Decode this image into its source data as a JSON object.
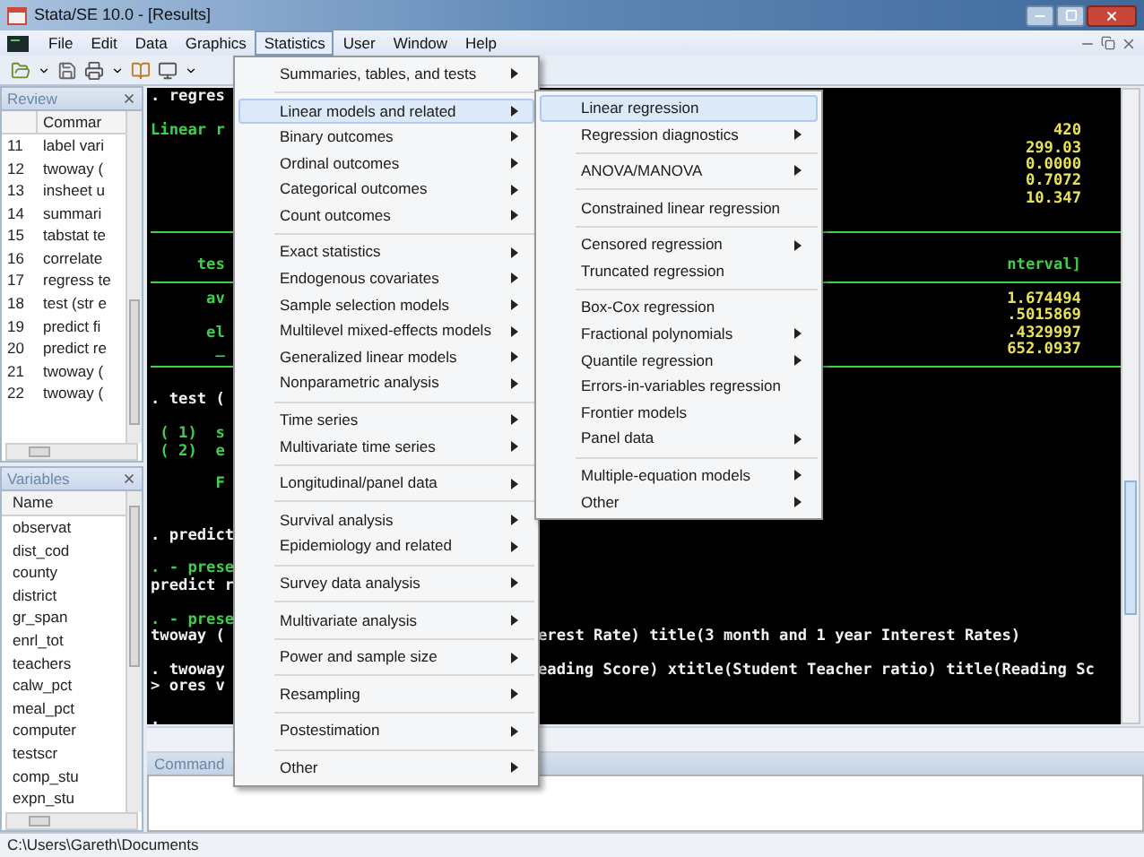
{
  "window": {
    "title": "Stata/SE 10.0 - [Results]"
  },
  "menubar": [
    {
      "label": "File",
      "selected": false
    },
    {
      "label": "Edit",
      "selected": false
    },
    {
      "label": "Data",
      "selected": false
    },
    {
      "label": "Graphics",
      "selected": false
    },
    {
      "label": "Statistics",
      "selected": true
    },
    {
      "label": "User",
      "selected": false
    },
    {
      "label": "Window",
      "selected": false
    },
    {
      "label": "Help",
      "selected": false
    }
  ],
  "review": {
    "title": "Review",
    "column": "Commar",
    "rows": [
      {
        "number": "11",
        "command": "label vari"
      },
      {
        "number": "12",
        "command": "twoway ("
      },
      {
        "number": "13",
        "command": "insheet u"
      },
      {
        "number": "14",
        "command": "summari"
      },
      {
        "number": "15",
        "command": "tabstat te"
      },
      {
        "number": "16",
        "command": "correlate"
      },
      {
        "number": "17",
        "command": "regress te"
      },
      {
        "number": "18",
        "command": "test (str e"
      },
      {
        "number": "19",
        "command": "predict fi"
      },
      {
        "number": "20",
        "command": "predict re"
      },
      {
        "number": "21",
        "command": "twoway ("
      },
      {
        "number": "22",
        "command": "twoway ("
      }
    ]
  },
  "variables": {
    "title": "Variables",
    "column": "Name",
    "items": [
      "observat",
      "dist_cod",
      "county",
      "district",
      "gr_span",
      "enrl_tot",
      "teachers",
      "calw_pct",
      "meal_pct",
      "computer",
      "testscr",
      "comp_stu",
      "expn_stu"
    ]
  },
  "results": [
    {
      "kind": "text",
      "left": {
        "text": ". regres",
        "color": "#f0f0f0"
      }
    },
    {
      "kind": "blank"
    },
    {
      "kind": "stat",
      "left": {
        "text": "Linear r",
        "color": "#3fd04a"
      },
      "right": {
        "text": "420",
        "color": "#e8e25a"
      }
    },
    {
      "kind": "stat",
      "right": {
        "text": "299.03",
        "color": "#e8e25a"
      }
    },
    {
      "kind": "stat",
      "right": {
        "text": "0.0000",
        "color": "#e8e25a"
      }
    },
    {
      "kind": "stat",
      "right": {
        "text": "0.7072",
        "color": "#e8e25a"
      }
    },
    {
      "kind": "stat",
      "right": {
        "text": "10.347",
        "color": "#e8e25a"
      }
    },
    {
      "kind": "blank"
    },
    {
      "kind": "rule"
    },
    {
      "kind": "blank"
    },
    {
      "kind": "stat",
      "left": {
        "text": "     tes",
        "color": "#3fd04a"
      },
      "right": {
        "text": "nterval]",
        "color": "#3fd04a"
      }
    },
    {
      "kind": "rule"
    },
    {
      "kind": "stat",
      "left": {
        "text": "      av",
        "color": "#3fd04a"
      },
      "right": {
        "text": "1.674494",
        "color": "#e8e25a"
      }
    },
    {
      "kind": "stat",
      "right": {
        "text": ".5015869",
        "color": "#e8e25a"
      }
    },
    {
      "kind": "stat",
      "left": {
        "text": "      el",
        "color": "#3fd04a"
      },
      "right": {
        "text": ".4329997",
        "color": "#e8e25a"
      }
    },
    {
      "kind": "stat",
      "left": {
        "text": "       _",
        "color": "#3fd04a"
      },
      "right": {
        "text": "652.0937",
        "color": "#e8e25a"
      }
    },
    {
      "kind": "rule"
    },
    {
      "kind": "blank"
    },
    {
      "kind": "text",
      "left": {
        "text": ". test (",
        "color": "#f0f0f0"
      }
    },
    {
      "kind": "blank"
    },
    {
      "kind": "text",
      "left": {
        "text": " ( 1)  s",
        "color": "#3fd04a"
      }
    },
    {
      "kind": "text",
      "left": {
        "text": " ( 2)  e",
        "color": "#3fd04a"
      }
    },
    {
      "kind": "blank"
    },
    {
      "kind": "text",
      "left": {
        "text": "       F",
        "color": "#3fd04a"
      }
    },
    {
      "kind": "blank"
    },
    {
      "kind": "blank"
    },
    {
      "kind": "text",
      "left": {
        "text": ". predict",
        "color": "#f0f0f0"
      }
    },
    {
      "kind": "blank"
    },
    {
      "kind": "text",
      "left": {
        "text": ". - prese",
        "color": "#3fd04a"
      }
    },
    {
      "kind": "text",
      "left": {
        "text": "predict r",
        "color": "#f0f0f0"
      }
    },
    {
      "kind": "blank"
    },
    {
      "kind": "text",
      "left": {
        "text": ". - prese",
        "color": "#3fd04a"
      }
    },
    {
      "kind": "text",
      "left": {
        "text": "twoway (",
        "color": "#f0f0f0"
      },
      "right": {
        "text": "erest Rate) title(3 month and 1 year Interest Rates)",
        "color": "#f0f0f0"
      }
    },
    {
      "kind": "blank"
    },
    {
      "kind": "text",
      "left": {
        "text": ". twoway",
        "color": "#f0f0f0"
      },
      "right": {
        "text": "eading Score) xtitle(Student Teacher ratio) title(Reading Sc",
        "color": "#f0f0f0"
      }
    },
    {
      "kind": "text",
      "left": {
        "text": "> ores v",
        "color": "#f0f0f0"
      }
    },
    {
      "kind": "blank"
    },
    {
      "kind": "text",
      "left": {
        "text": ".",
        "color": "#f0f0f0"
      }
    }
  ],
  "command": {
    "title": "Command"
  },
  "status_bar": "C:\\Users\\Gareth\\Documents",
  "statistics_menu": [
    [
      {
        "label": "Summaries, tables, and tests",
        "submenu": true,
        "selected": false
      }
    ],
    [
      {
        "label": "Linear models and related",
        "submenu": true,
        "selected": true
      },
      {
        "label": "Binary outcomes",
        "submenu": true,
        "selected": false
      },
      {
        "label": "Ordinal outcomes",
        "submenu": true,
        "selected": false
      },
      {
        "label": "Categorical outcomes",
        "submenu": true,
        "selected": false
      },
      {
        "label": "Count outcomes",
        "submenu": true,
        "selected": false
      }
    ],
    [
      {
        "label": "Exact statistics",
        "submenu": true,
        "selected": false
      },
      {
        "label": "Endogenous covariates",
        "submenu": true,
        "selected": false
      },
      {
        "label": "Sample selection models",
        "submenu": true,
        "selected": false
      },
      {
        "label": "Multilevel mixed-effects models",
        "submenu": true,
        "selected": false
      },
      {
        "label": "Generalized linear models",
        "submenu": true,
        "selected": false
      },
      {
        "label": "Nonparametric analysis",
        "submenu": true,
        "selected": false
      }
    ],
    [
      {
        "label": "Time series",
        "submenu": true,
        "selected": false
      },
      {
        "label": "Multivariate time series",
        "submenu": true,
        "selected": false
      }
    ],
    [
      {
        "label": "Longitudinal/panel data",
        "submenu": true,
        "selected": false
      }
    ],
    [
      {
        "label": "Survival analysis",
        "submenu": true,
        "selected": false
      },
      {
        "label": "Epidemiology and related",
        "submenu": true,
        "selected": false
      }
    ],
    [
      {
        "label": "Survey data analysis",
        "submenu": true,
        "selected": false
      }
    ],
    [
      {
        "label": "Multivariate analysis",
        "submenu": true,
        "selected": false
      }
    ],
    [
      {
        "label": "Power and sample size",
        "submenu": true,
        "selected": false
      }
    ],
    [
      {
        "label": "Resampling",
        "submenu": true,
        "selected": false
      }
    ],
    [
      {
        "label": "Postestimation",
        "submenu": true,
        "selected": false
      }
    ],
    [
      {
        "label": "Other",
        "submenu": true,
        "selected": false
      }
    ]
  ],
  "linear_models_submenu": [
    [
      {
        "label": "Linear regression",
        "submenu": false,
        "selected": true
      },
      {
        "label": "Regression diagnostics",
        "submenu": true,
        "selected": false
      }
    ],
    [
      {
        "label": "ANOVA/MANOVA",
        "submenu": true,
        "selected": false
      }
    ],
    [
      {
        "label": "Constrained linear regression",
        "submenu": false,
        "selected": false
      }
    ],
    [
      {
        "label": "Censored regression",
        "submenu": true,
        "selected": false
      },
      {
        "label": "Truncated regression",
        "submenu": false,
        "selected": false
      }
    ],
    [
      {
        "label": "Box-Cox regression",
        "submenu": false,
        "selected": false
      },
      {
        "label": "Fractional polynomials",
        "submenu": true,
        "selected": false
      },
      {
        "label": "Quantile regression",
        "submenu": true,
        "selected": false
      },
      {
        "label": "Errors-in-variables regression",
        "submenu": false,
        "selected": false
      },
      {
        "label": "Frontier models",
        "submenu": false,
        "selected": false
      },
      {
        "label": "Panel data",
        "submenu": true,
        "selected": false
      }
    ],
    [
      {
        "label": "Multiple-equation models",
        "submenu": true,
        "selected": false
      },
      {
        "label": "Other",
        "submenu": true,
        "selected": false
      }
    ]
  ]
}
